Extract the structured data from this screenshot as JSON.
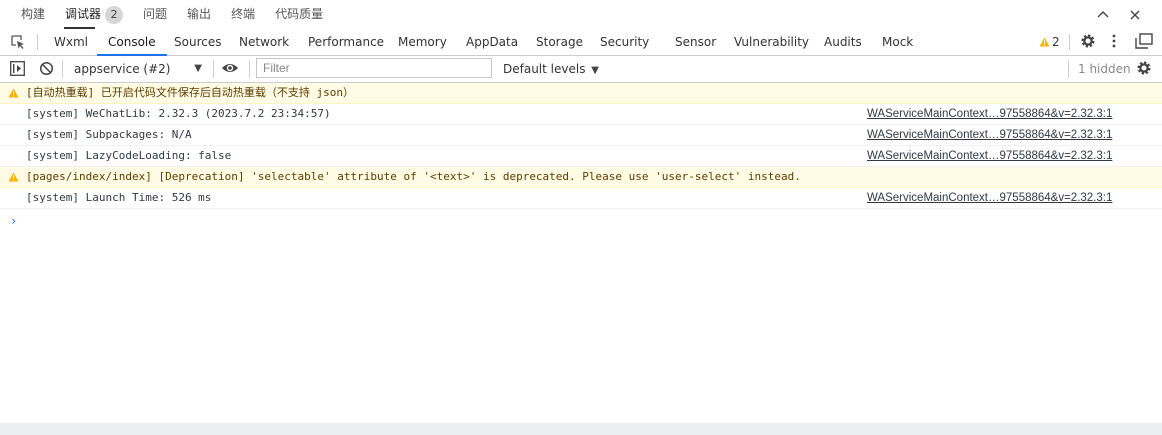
{
  "top_tabs": [
    {
      "label": "构建"
    },
    {
      "label": "调试器",
      "badge": "2",
      "active": true
    },
    {
      "label": "问题"
    },
    {
      "label": "输出"
    },
    {
      "label": "终端"
    },
    {
      "label": "代码质量"
    }
  ],
  "devtools_tabs": [
    "Wxml",
    "Console",
    "Sources",
    "Network",
    "Performance",
    "Memory",
    "AppData",
    "Storage",
    "Security",
    "Sensor",
    "Vulnerability",
    "Audits",
    "Mock"
  ],
  "active_devtools_tab": "Console",
  "warning_count": "2",
  "toolbar": {
    "context": "appservice (#2)",
    "filter_placeholder": "Filter",
    "levels": "Default levels",
    "hidden": "1 hidden"
  },
  "console_rows": [
    {
      "type": "warn",
      "message": "[自动热重载] 已开启代码文件保存后自动热重载（不支持 json）",
      "source": ""
    },
    {
      "type": "log",
      "message": "[system] WeChatLib: 2.32.3 (2023.7.2 23:34:57)",
      "source": "WAServiceMainContext…97558864&v=2.32.3:1"
    },
    {
      "type": "log",
      "message": "[system] Subpackages: N/A",
      "source": "WAServiceMainContext…97558864&v=2.32.3:1"
    },
    {
      "type": "log",
      "message": "[system] LazyCodeLoading: false",
      "source": "WAServiceMainContext…97558864&v=2.32.3:1"
    },
    {
      "type": "warn",
      "message": "[pages/index/index] [Deprecation] 'selectable' attribute of '<text>' is deprecated. Please use 'user-select' instead.",
      "source": ""
    },
    {
      "type": "log",
      "message": "[system] Launch Time: 526 ms",
      "source": "WAServiceMainContext…97558864&v=2.32.3:1"
    }
  ],
  "colors": {
    "accent": "#1a73e8",
    "warning": "#f4b400",
    "warning_bg": "#fffbe5"
  }
}
